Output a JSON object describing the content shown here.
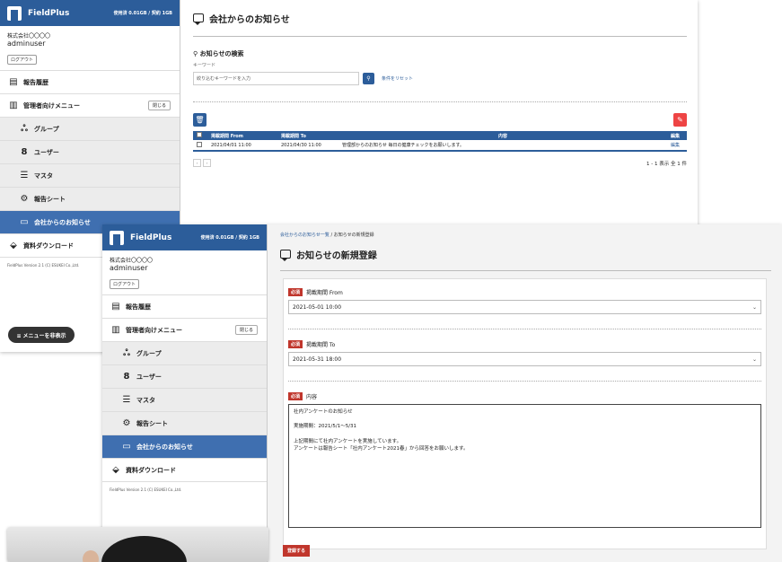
{
  "app": {
    "name": "FieldPlus",
    "usage": "使用済 0.01GB / 契約 1GB",
    "company": "株式会社〇〇〇〇",
    "user": "adminuser",
    "logout": "ログアウト",
    "version": "FieldPlus Version 2.1 (C) ESUKEI Co.,Ltd."
  },
  "nav": {
    "report_history": "報告履歴",
    "admin_menu": "管理者向けメニュー",
    "close": "閉じる",
    "group": "グループ",
    "user": "ユーザー",
    "master": "マスタ",
    "report_sheet": "報告シート",
    "news": "会社からのお知らせ",
    "download": "資料ダウンロード",
    "hide_menu": "≡ メニューを非表示"
  },
  "list_page": {
    "title": "会社からのお知らせ",
    "search_heading": "お知らせの検索",
    "keyword_label": "キーワード",
    "keyword_placeholder": "絞り込むキーワードを入力",
    "reset": "条件をリセット",
    "columns": [
      "掲載期間 From",
      "掲載期間 To",
      "内容",
      "編集"
    ],
    "rows": [
      {
        "from": "2021/04/01 11:00",
        "to": "2021/04/30 11:00",
        "content": "管理部からのお知らせ 毎日の健康チェックをお願いします。",
        "edit": "編集"
      }
    ],
    "pager_prev": "‹",
    "pager_next": "›",
    "count": "1 - 1 表示 全 1 件"
  },
  "form_page": {
    "breadcrumb_link": "会社からのお知らせ一覧",
    "breadcrumb_current": "お知らせの新規登録",
    "title": "お知らせの新規登録",
    "required": "必須",
    "from_label": "掲載期間 From",
    "from_value": "2021-05-01 10:00",
    "to_label": "掲載期間 To",
    "to_value": "2021-05-31 18:00",
    "content_label": "内容",
    "content_lines": [
      "社内アンケートのお知らせ",
      "",
      "実施期間：2021/5/1～5/31",
      "",
      "上記期間にて社内アンケートを実施しています。",
      "アンケートは報告シート「社内アンケート2021春」から回答をお願いします。"
    ],
    "submit": "登録する"
  },
  "colors": {
    "primary": "#2c5d9a",
    "active_nav": "#3f6fb0",
    "danger": "#c0362c",
    "edit_button": "#e44444"
  }
}
